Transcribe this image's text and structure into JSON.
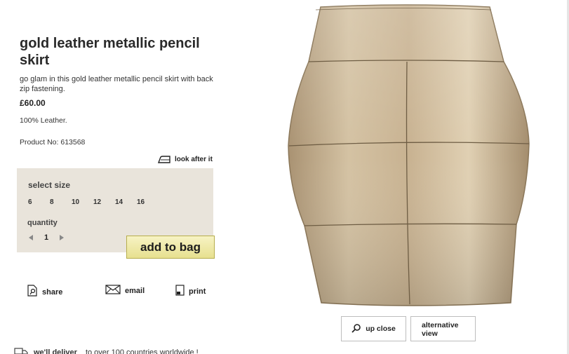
{
  "product": {
    "title": "gold leather metallic pencil skirt",
    "description": "go glam in this gold leather metallic pencil skirt with back zip fastening.",
    "price": "£60.00",
    "material": "100% Leather.",
    "product_no": "Product No: 613568"
  },
  "care": {
    "label": "look after it",
    "icon": "iron-icon"
  },
  "size_panel": {
    "label": "select size",
    "sizes": [
      "6",
      "8",
      "10",
      "12",
      "14",
      "16"
    ],
    "quantity_label": "quantity",
    "quantity": "1"
  },
  "actions": {
    "add_to_bag": "add to bag",
    "share": "share",
    "email": "email",
    "print": "print"
  },
  "delivery": {
    "bold": "we'll deliver",
    "rest": "to over 100 countries worldwide !"
  },
  "image_controls": {
    "up_close": "up close",
    "alternative_view": "alternative view"
  },
  "colors": {
    "panel_bg": "#e9e4db",
    "button_bg": "#ece59a",
    "skirt_gold": "#c9b494"
  }
}
